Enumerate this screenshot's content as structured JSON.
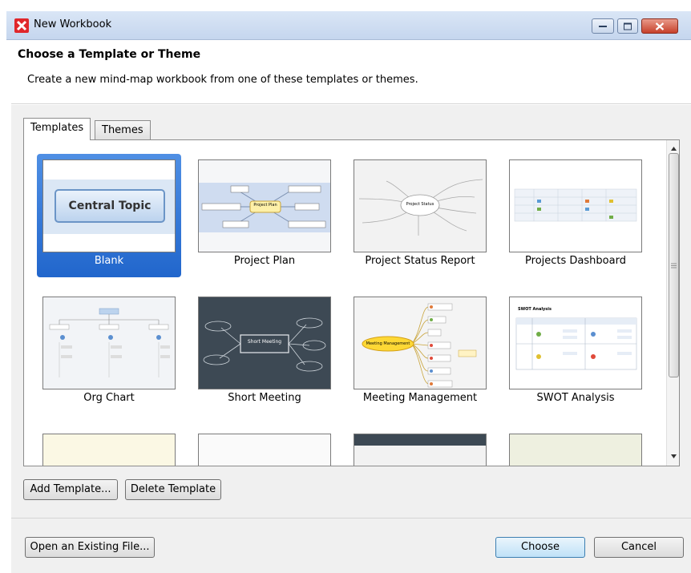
{
  "window": {
    "title": "New Workbook"
  },
  "header": {
    "title": "Choose a Template or Theme",
    "description": "Create a new mind-map workbook from one of these templates or themes."
  },
  "tabs": [
    {
      "label": "Templates",
      "active": true
    },
    {
      "label": "Themes",
      "active": false
    }
  ],
  "templates": [
    {
      "label": "Blank",
      "selected": true,
      "thumb_text": "Central Topic"
    },
    {
      "label": "Project Plan",
      "selected": false,
      "thumb_text": "Project Plan"
    },
    {
      "label": "Project Status Report",
      "selected": false,
      "thumb_text": "Project Status"
    },
    {
      "label": "Projects Dashboard",
      "selected": false
    },
    {
      "label": "Org Chart",
      "selected": false
    },
    {
      "label": "Short Meeting",
      "selected": false,
      "thumb_text": "Short Meeting"
    },
    {
      "label": "Meeting Management",
      "selected": false,
      "thumb_text": "Meeting Management"
    },
    {
      "label": "SWOT Analysis",
      "selected": false,
      "thumb_text": "SWOT Analysis"
    }
  ],
  "buttons": {
    "add_template": "Add Template...",
    "delete_template": "Delete Template",
    "open_existing": "Open an Existing File...",
    "choose": "Choose",
    "cancel": "Cancel"
  },
  "colors": {
    "selection": "#2c73d6",
    "titlebar": "#c5d6ee",
    "close_button": "#c7412b",
    "app_logo": "#e0272b"
  }
}
